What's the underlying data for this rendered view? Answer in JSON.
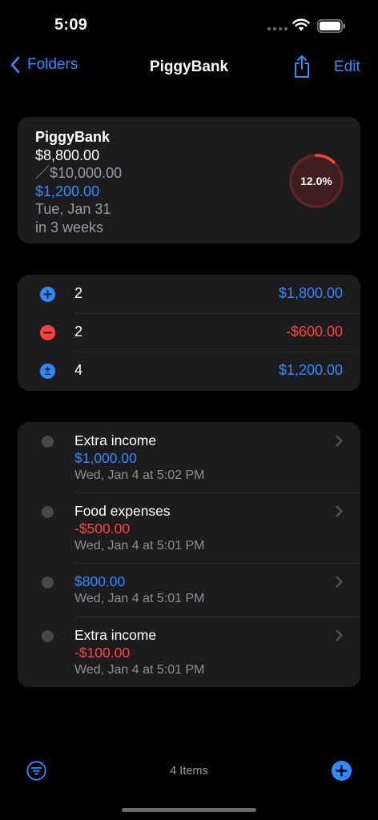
{
  "status": {
    "time": "5:09"
  },
  "nav": {
    "back_label": "Folders",
    "title": "PiggyBank",
    "edit_label": "Edit"
  },
  "summary": {
    "name": "PiggyBank",
    "current": "$8,800.00",
    "target": "／$10,000.00",
    "remaining": "$1,200.00",
    "date": "Tue, Jan 31",
    "relative": "in 3 weeks",
    "progress_label": "12.0%",
    "progress_fraction": 0.12
  },
  "stats": [
    {
      "icon": "plus-circle-icon",
      "count": "2",
      "amount": "$1,800.00",
      "tone": "positive"
    },
    {
      "icon": "minus-circle-icon",
      "count": "2",
      "amount": "-$600.00",
      "tone": "negative"
    },
    {
      "icon": "plus-minus-circle-icon",
      "count": "4",
      "amount": "$1,200.00",
      "tone": "positive"
    }
  ],
  "transactions": [
    {
      "title": "Extra income",
      "amount": "$1,000.00",
      "date": "Wed, Jan 4 at 5:02 PM",
      "tone": "positive"
    },
    {
      "title": "Food expenses",
      "amount": "-$500.00",
      "date": "Wed, Jan 4 at 5:01 PM",
      "tone": "negative"
    },
    {
      "title": "",
      "amount": "$800.00",
      "date": "Wed, Jan 4 at 5:01 PM",
      "tone": "positive"
    },
    {
      "title": "Extra income",
      "amount": "-$100.00",
      "date": "Wed, Jan 4 at 5:01 PM",
      "tone": "negative"
    }
  ],
  "toolbar": {
    "items_count": "4 Items"
  },
  "colors": {
    "accent": "#2f8cff",
    "negative": "#ff453a",
    "card": "#1c1c1e",
    "background": "#000000"
  }
}
